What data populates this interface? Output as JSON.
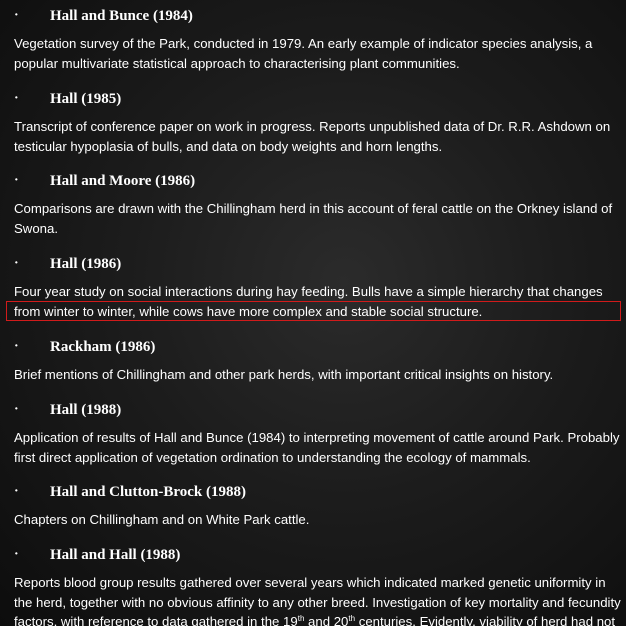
{
  "entries": [
    {
      "bullet": "·",
      "heading": "Hall and Bunce (1984)",
      "lines": [
        "Vegetation survey of the Park, conducted in 1979. An early example of indicator species analysis, a",
        "popular multivariate statistical approach to characterising plant communities."
      ]
    },
    {
      "bullet": "·",
      "heading": "Hall (1985)",
      "lines": [
        "Transcript of conference paper on work in progress. Reports unpublished data of Dr. R.R. Ashdown on",
        "testicular hypoplasia of bulls, and data on body weights and horn lengths."
      ]
    },
    {
      "bullet": "·",
      "heading": "Hall and Moore (1986)",
      "lines": [
        "Comparisons are drawn with the Chillingham herd in this account of feral cattle on the Orkney island of",
        "Swona."
      ]
    },
    {
      "bullet": "·",
      "heading": "Hall (1986)",
      "lines": [
        "Four year study on social interactions during hay feeding. Bulls have a simple hierarchy that changes",
        "from winter to winter, while cows have more complex and stable social structure."
      ]
    },
    {
      "bullet": "·",
      "heading": "Rackham (1986)",
      "lines": [
        "Brief mentions of Chillingham and other park herds, with important critical insights on history."
      ]
    },
    {
      "bullet": "·",
      "heading": "Hall (1988)",
      "lines": [
        "Application of results of Hall and Bunce (1984) to interpreting movement of cattle around Park. Probably",
        "first direct application of vegetation ordination to understanding the ecology of mammals."
      ]
    },
    {
      "bullet": "·",
      "heading": "Hall and Clutton-Brock (1988)",
      "lines": [
        "Chapters on Chillingham and on White Park cattle."
      ]
    },
    {
      "bullet": "·",
      "heading": "Hall and Hall (1988)",
      "lines": [
        "Reports blood group results gathered over several years which indicated marked genetic uniformity in",
        "the herd, together with no obvious affinity to any other breed. Investigation of key mortality and fecundity"
      ],
      "last_line": {
        "part1": "factors, with reference to data gathered in the 19",
        "sup1": "th",
        "part2": " and 20",
        "sup2": "th",
        "part3": " centuries. Evidently, viability of herd had not"
      }
    }
  ]
}
